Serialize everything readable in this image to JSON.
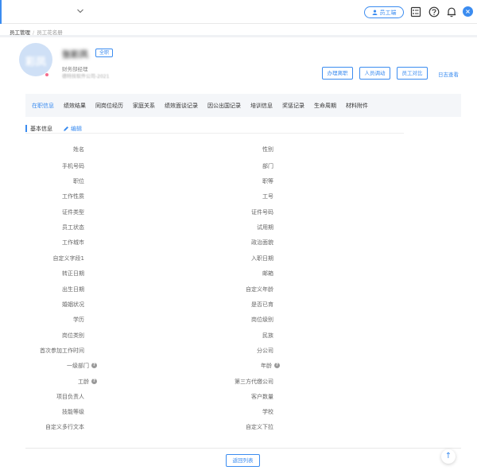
{
  "topbar": {
    "employee_button_label": "员工端"
  },
  "breadcrumb": {
    "root": "员工管理",
    "separator": "/",
    "current": "员工花名册"
  },
  "profile": {
    "avatar_text": "彩凤",
    "name": "张彩凤",
    "status_tag": "全职",
    "position": "财务部经理",
    "org_info": "德特技软件公司-2021"
  },
  "actions": {
    "resign": "办理离职",
    "transfer": "人员调动",
    "compare": "员工对比",
    "log": "日志查看"
  },
  "tabs": [
    {
      "label": "在职信息",
      "active": true
    },
    {
      "label": "绩效结果",
      "active": false
    },
    {
      "label": "同岗位经历",
      "active": false
    },
    {
      "label": "家庭关系",
      "active": false
    },
    {
      "label": "绩效面谈记录",
      "active": false
    },
    {
      "label": "因公出国记录",
      "active": false
    },
    {
      "label": "培训信息",
      "active": false
    },
    {
      "label": "奖惩记录",
      "active": false
    },
    {
      "label": "生命周期",
      "active": false
    },
    {
      "label": "材料附件",
      "active": false
    }
  ],
  "section": {
    "title": "基本信息",
    "edit_label": "编辑"
  },
  "fields_left": [
    {
      "label": "姓名"
    },
    {
      "label": "手机号码"
    },
    {
      "label": "职位"
    },
    {
      "label": "工作性质"
    },
    {
      "label": "证件类型"
    },
    {
      "label": "员工状态"
    },
    {
      "label": "工作城市"
    },
    {
      "label": "自定义字段1"
    },
    {
      "label": "转正日期"
    },
    {
      "label": "出生日期"
    },
    {
      "label": "婚姻状况"
    },
    {
      "label": "学历"
    },
    {
      "label": "岗位类别"
    },
    {
      "label": "首次参加工作时间"
    },
    {
      "label": "一级部门",
      "help": true
    },
    {
      "label": "工龄",
      "help": true
    },
    {
      "label": "项目负责人"
    },
    {
      "label": "技能等级"
    },
    {
      "label": "自定义多行文本"
    }
  ],
  "fields_right": [
    {
      "label": "性别"
    },
    {
      "label": "部门"
    },
    {
      "label": "职等"
    },
    {
      "label": "工号"
    },
    {
      "label": "证件号码"
    },
    {
      "label": "试用期"
    },
    {
      "label": "政治面貌"
    },
    {
      "label": "入职日期"
    },
    {
      "label": "邮箱"
    },
    {
      "label": "自定义年龄"
    },
    {
      "label": "是否已育"
    },
    {
      "label": "岗位级别"
    },
    {
      "label": "民族"
    },
    {
      "label": "分公司"
    },
    {
      "label": "年龄",
      "help": true
    },
    {
      "label": "第三方代缴公司"
    },
    {
      "label": "客户数量"
    },
    {
      "label": "学校"
    },
    {
      "label": "自定义下拉"
    }
  ],
  "bottom": {
    "back_label": "返回列表"
  },
  "icons": {
    "help": "?",
    "scroll_top": "↑"
  },
  "colors": {
    "accent": "#3b8cf0"
  }
}
